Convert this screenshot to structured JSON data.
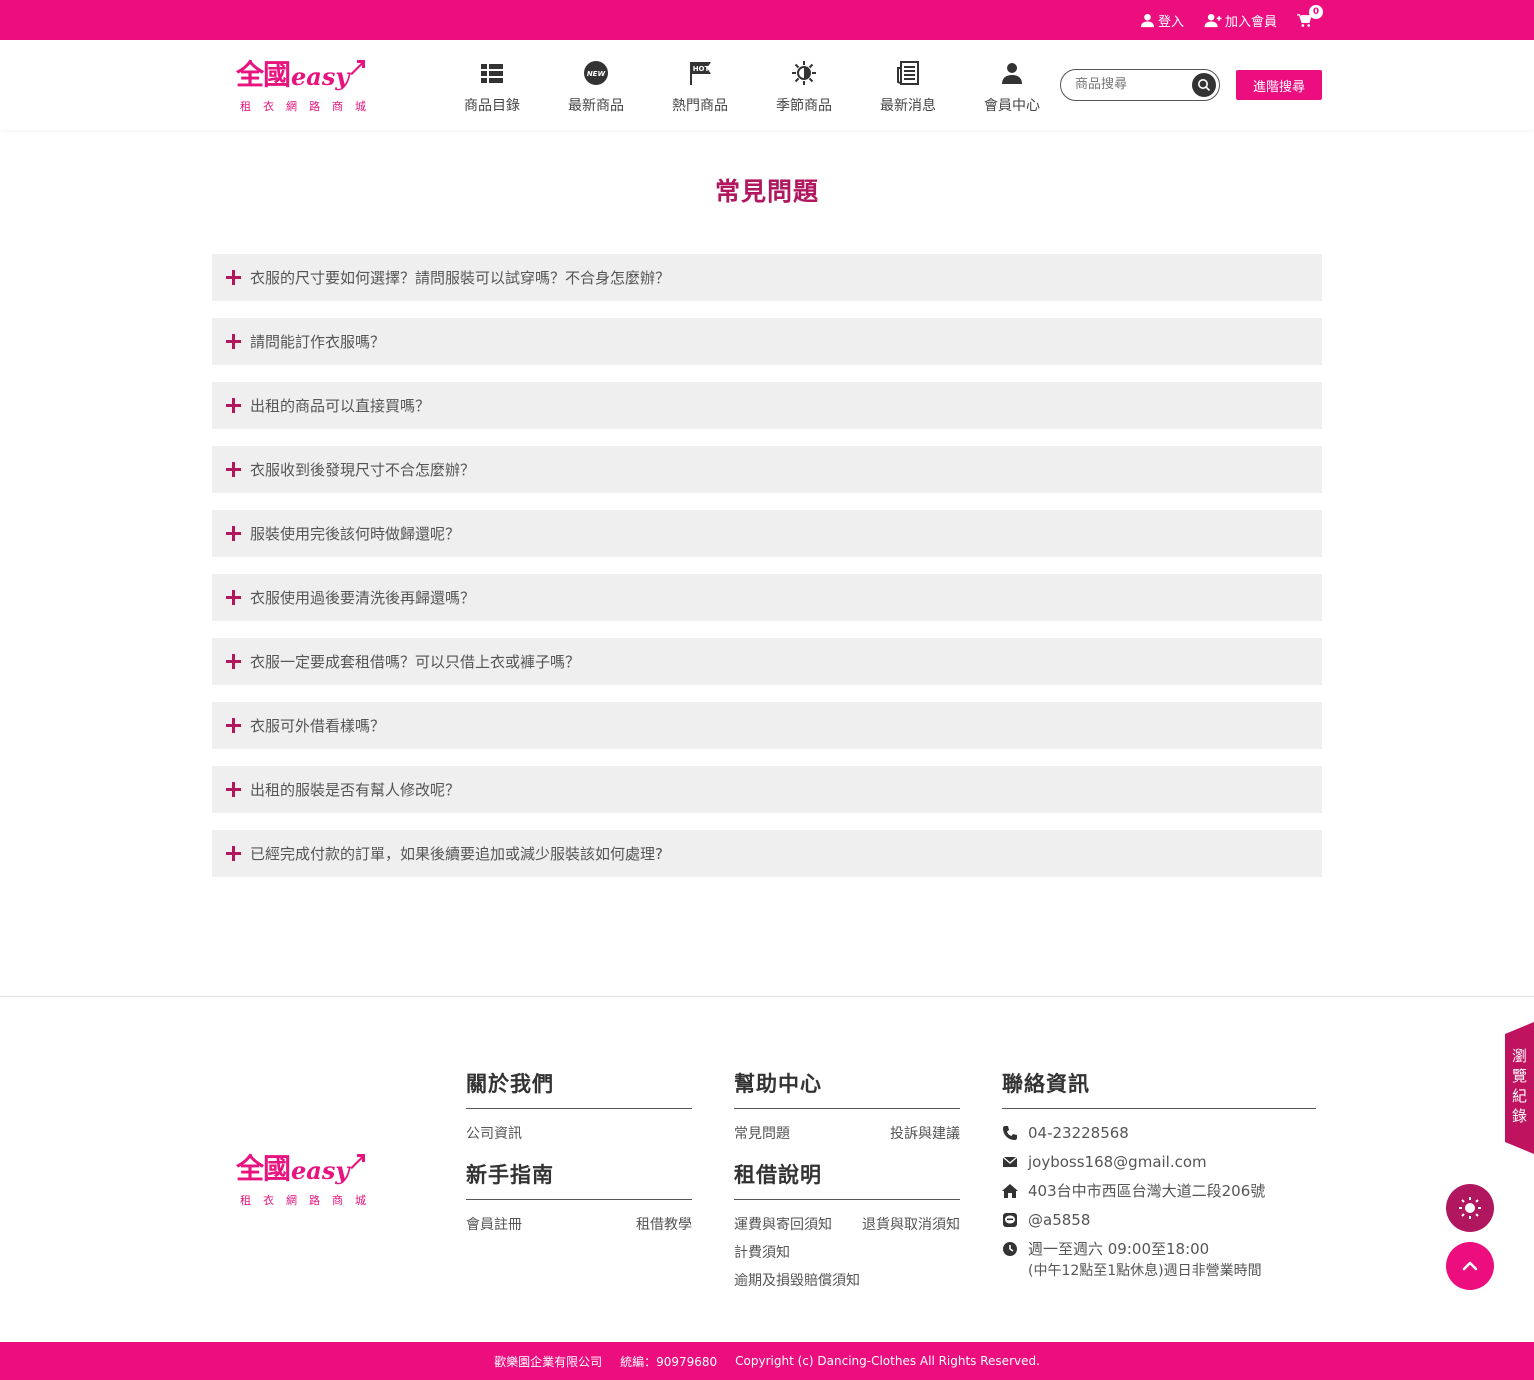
{
  "topbar": {
    "login": "登入",
    "join": "加入會員",
    "cart_count": "0"
  },
  "logo": {
    "name": "全國",
    "easy": "easy",
    "subtitle": "租衣網路商城"
  },
  "nav": [
    {
      "label": "商品目錄",
      "icon": "list-icon"
    },
    {
      "label": "最新商品",
      "icon": "new-badge-icon"
    },
    {
      "label": "熱門商品",
      "icon": "hot-flag-icon"
    },
    {
      "label": "季節商品",
      "icon": "sun-snowflake-icon"
    },
    {
      "label": "最新消息",
      "icon": "newspaper-icon"
    },
    {
      "label": "會員中心",
      "icon": "user-icon"
    }
  ],
  "search": {
    "placeholder": "商品搜尋",
    "advanced_label": "進階搜尋"
  },
  "page_title": "常見問題",
  "faq": [
    "衣服的尺寸要如何選擇？請問服裝可以試穿嗎？不合身怎麼辦？",
    "請問能訂作衣服嗎？",
    "出租的商品可以直接買嗎？",
    "衣服收到後發現尺寸不合怎麼辦？",
    "服裝使用完後該何時做歸還呢？",
    "衣服使用過後要清洗後再歸還嗎？",
    "衣服一定要成套租借嗎？可以只借上衣或褲子嗎？",
    "衣服可外借看樣嗎？",
    "出租的服裝是否有幫人修改呢？",
    "已經完成付款的訂單，如果後續要追加或減少服裝該如何處理?"
  ],
  "footer": {
    "about": {
      "title": "關於我們",
      "links": [
        "公司資訊"
      ]
    },
    "guide": {
      "title": "新手指南",
      "links": [
        "會員註冊",
        "租借教學"
      ]
    },
    "help": {
      "title": "幫助中心",
      "links": [
        "常見問題",
        "投訴與建議"
      ]
    },
    "rental": {
      "title": "租借說明",
      "links": [
        "運費與寄回須知",
        "退貨與取消須知",
        "計費須知",
        "逾期及損毀賠償須知"
      ]
    },
    "contact": {
      "title": "聯絡資訊",
      "phone": "04-23228568",
      "email": "joyboss168@gmail.com",
      "address": "403台中市西區台灣大道二段206號",
      "line": "@a5858",
      "hours": "週一至週六 09:00至18:00",
      "hours_note": "(中午12點至1點休息)週日非營業時間"
    }
  },
  "history_tab": "瀏覽紀錄",
  "bottombar": {
    "company": "歡樂園企業有限公司",
    "tax_id": "統編：90979680",
    "copyright": "Copyright (c) Dancing-Clothes All Rights Reserved."
  },
  "colors": {
    "brand_pink": "#ec0e7f",
    "title_maroon": "#b0175f",
    "faq_bg": "#efefef"
  }
}
